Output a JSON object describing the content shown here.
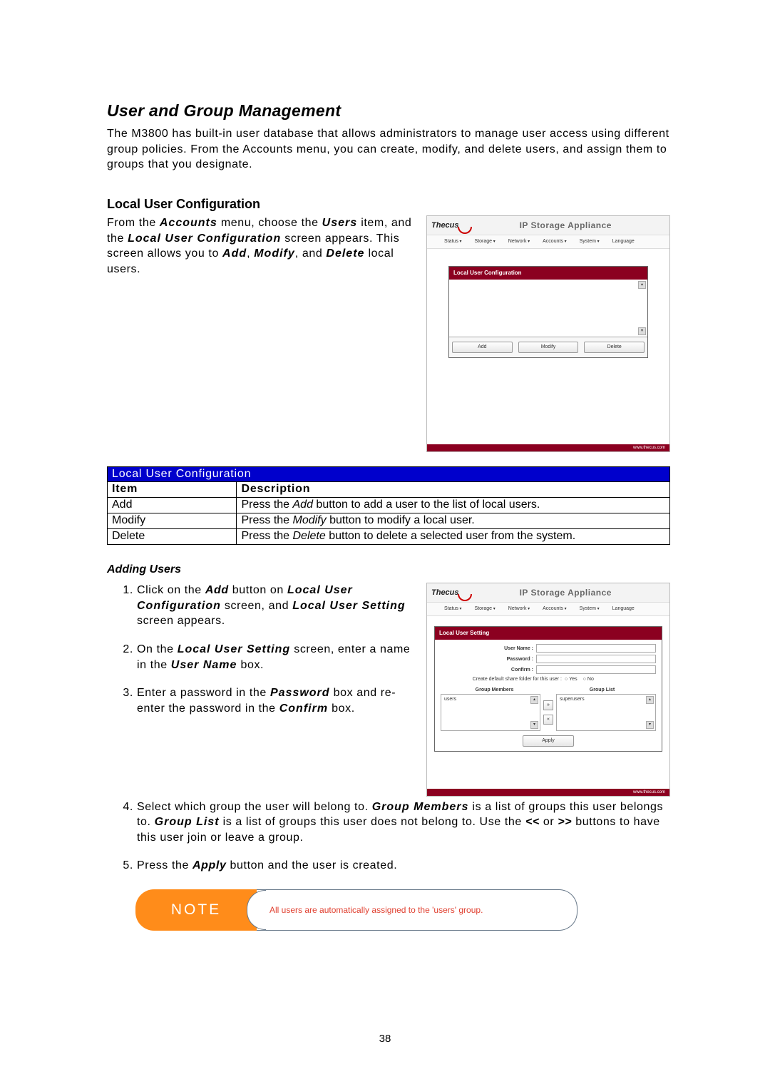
{
  "heading": "User and Group Management",
  "intro": "The M3800 has built-in user database that allows administrators to manage user access using different group policies. From the Accounts menu, you can create, modify, and delete users, and assign them to groups that you designate.",
  "sub1": {
    "title": "Local User Configuration",
    "text_before_kw1": "From the ",
    "kw1": "Accounts",
    "text_mid1": " menu, choose the ",
    "kw2": "Users",
    "text_mid2": " item, and the ",
    "kw3": "Local User Configuration",
    "text_mid3": " screen appears. This screen allows you to ",
    "kw4": "Add",
    "text_mid4": ", ",
    "kw5": "Modify",
    "text_mid5": ", and ",
    "kw6": "Delete",
    "text_after": " local users."
  },
  "ui1": {
    "logo": "Thecus",
    "title": "IP Storage Appliance",
    "menu": [
      "Status",
      "Storage",
      "Network",
      "Accounts",
      "System",
      "Language"
    ],
    "panel_title": "Local User Configuration",
    "buttons": {
      "add": "Add",
      "modify": "Modify",
      "delete": "Delete"
    },
    "footer": "www.thecus.com"
  },
  "table": {
    "title": "Local User Configuration",
    "head_item": "Item",
    "head_desc": "Description",
    "rows": [
      {
        "item": "Add",
        "kw": "Add",
        "pre": "Press the ",
        "post": " button to add a user to the list of local users."
      },
      {
        "item": "Modify",
        "kw": "Modify",
        "pre": "Press the ",
        "post": " button to modify a local user."
      },
      {
        "item": "Delete",
        "kw": "Delete",
        "pre": "Press the ",
        "post": " button to delete a selected user from the system."
      }
    ]
  },
  "sub2": {
    "title": "Adding Users",
    "steps": {
      "s1a": "Click on the ",
      "s1kw1": "Add",
      "s1b": " button on ",
      "s1kw2": "Local User Configuration",
      "s1c": " screen, and ",
      "s1kw3": "Local User Setting",
      "s1d": " screen appears.",
      "s2a": "On the ",
      "s2kw1": "Local User Setting",
      "s2b": " screen, enter a name in the ",
      "s2kw2": "User Name",
      "s2c": " box.",
      "s3a": "Enter a password in the ",
      "s3kw1": "Password",
      "s3b": " box and re-enter the password in the ",
      "s3kw2": "Confirm",
      "s3c": " box.",
      "s4a": "Select which group the user will belong to. ",
      "s4kw1": "Group Members",
      "s4b": " is a list of groups this user belongs to. ",
      "s4kw2": "Group List",
      "s4c": " is a list of groups this user does not belong to. Use the ",
      "s4kw3": "<<",
      "s4d": " or ",
      "s4kw4": ">>",
      "s4e": " buttons to have this user join or leave a group.",
      "s5a": "Press the ",
      "s5kw1": "Apply",
      "s5b": " button and the user is created."
    }
  },
  "ui2": {
    "panel_title": "Local User Setting",
    "fields": {
      "user_name": "User Name :",
      "password": "Password :",
      "confirm": "Confirm :",
      "share_label": "Create default share folder for this user :",
      "yes": "Yes",
      "no": "No"
    },
    "group_members_hdr": "Group Members",
    "group_list_hdr": "Group List",
    "group_members_item": "users",
    "group_list_item": "superusers",
    "apply": "Apply"
  },
  "note": {
    "label": "NOTE",
    "text": "All users are automatically assigned to the 'users' group."
  },
  "page_number": "38"
}
